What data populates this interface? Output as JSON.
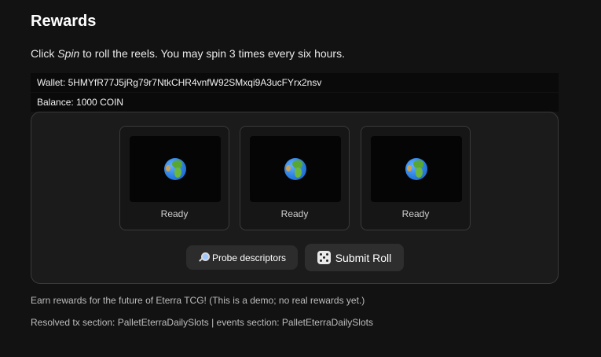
{
  "title": "Rewards",
  "intro": {
    "prefix": "Click ",
    "action": "Spin",
    "suffix": " to roll the reels. You may spin 3 times every six hours."
  },
  "wallet": {
    "label": "Wallet: 5HMYfR77J5jRg79r7NtkCHR4vnfW92SMxqi9A3ucFYrx2nsv",
    "balance": "Balance: 1000 COIN"
  },
  "reels": [
    {
      "symbol": "globe-icon",
      "status": "Ready"
    },
    {
      "symbol": "globe-icon",
      "status": "Ready"
    },
    {
      "symbol": "globe-icon",
      "status": "Ready"
    }
  ],
  "buttons": {
    "probe_label": "Probe descriptors",
    "probe_icon": "magnifier-icon",
    "submit_label": "Submit Roll",
    "submit_icon": "dice-icon"
  },
  "notes": {
    "earn": "Earn rewards for the future of Eterra TCG! (This is a demo; no real rewards yet.)",
    "resolved": "Resolved tx section: PalletEterraDailySlots | events section: PalletEterraDailySlots"
  },
  "colors": {
    "background": "#121212",
    "panel": "#1b1b1b",
    "reel_window": "#050505"
  }
}
